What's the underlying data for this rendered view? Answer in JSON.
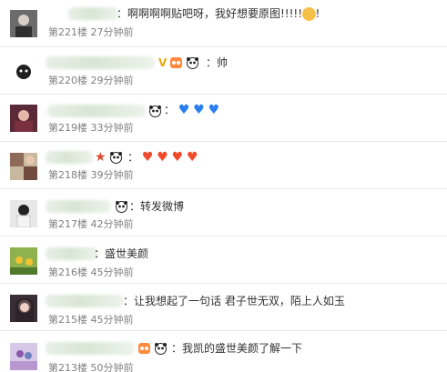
{
  "comments": [
    {
      "floor_time": "第221楼 27分钟前",
      "text": "：啊啊啊啊贴吧呀，我好想要原图!!!!!!!!!"
    },
    {
      "floor_time": "第220楼 29分钟前",
      "text": "：帅"
    },
    {
      "floor_time": "第219楼 33分钟前",
      "text": ""
    },
    {
      "floor_time": "第218楼 39分钟前",
      "text": "："
    },
    {
      "floor_time": "第217楼 42分钟前",
      "text": "：转发微博"
    },
    {
      "floor_time": "第216楼 45分钟前",
      "text": "：盛世美颜"
    },
    {
      "floor_time": "第215楼 45分钟前",
      "text": "：让我想起了一句话 君子世无双，陌上人如玉"
    },
    {
      "floor_time": "第213楼 50分钟前",
      "text": "：我凯的盛世美颜了解一下"
    }
  ],
  "icons": {
    "verified": "V",
    "panda": "panda-icon",
    "star": "★",
    "heart": "♥"
  },
  "colors": {
    "meta_text": "#808080",
    "comment_text": "#333333",
    "heart_blue": "#2a7ef0",
    "heart_red": "#f04a2a",
    "verified": "#f0a500"
  }
}
